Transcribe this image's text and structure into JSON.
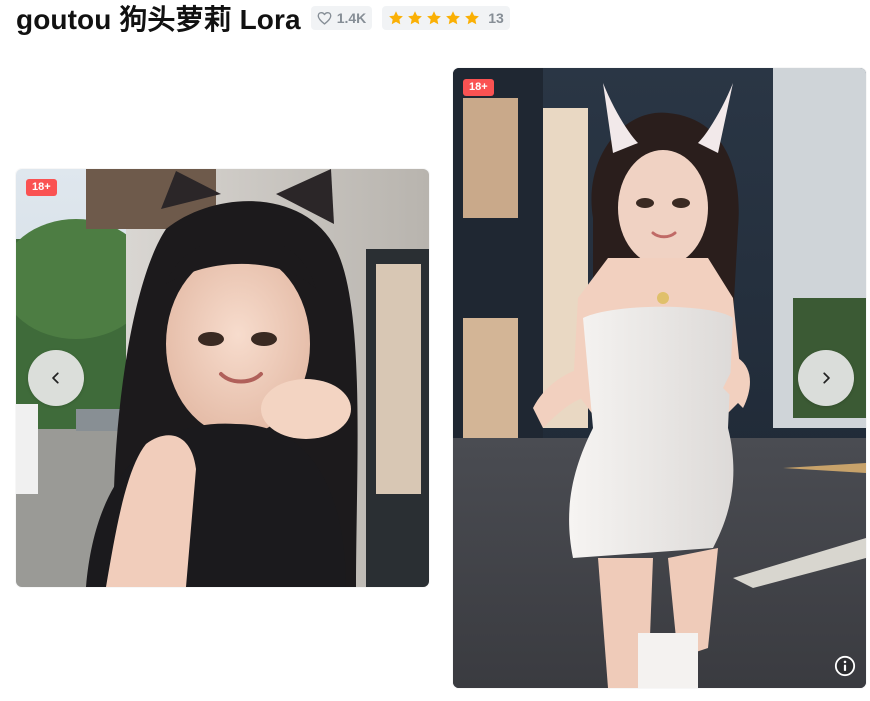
{
  "model": {
    "title": "goutou 狗头萝莉 Lora",
    "likes": "1.4K",
    "rating_count": "13",
    "rating_stars": 5
  },
  "gallery": {
    "nsfw_badge": "18+",
    "images": [
      {
        "description_icon": "photo"
      },
      {
        "description_icon": "photo"
      }
    ]
  },
  "colors": {
    "accent_star": "#fab005",
    "nsfw_red": "#fa5252",
    "badge_bg": "#f1f3f5",
    "muted_text": "#868e96"
  },
  "icons": {
    "likes": "heart-icon",
    "rating": "star-icon",
    "prev": "chevron-left-icon",
    "next": "chevron-right-icon",
    "info": "info-icon"
  }
}
